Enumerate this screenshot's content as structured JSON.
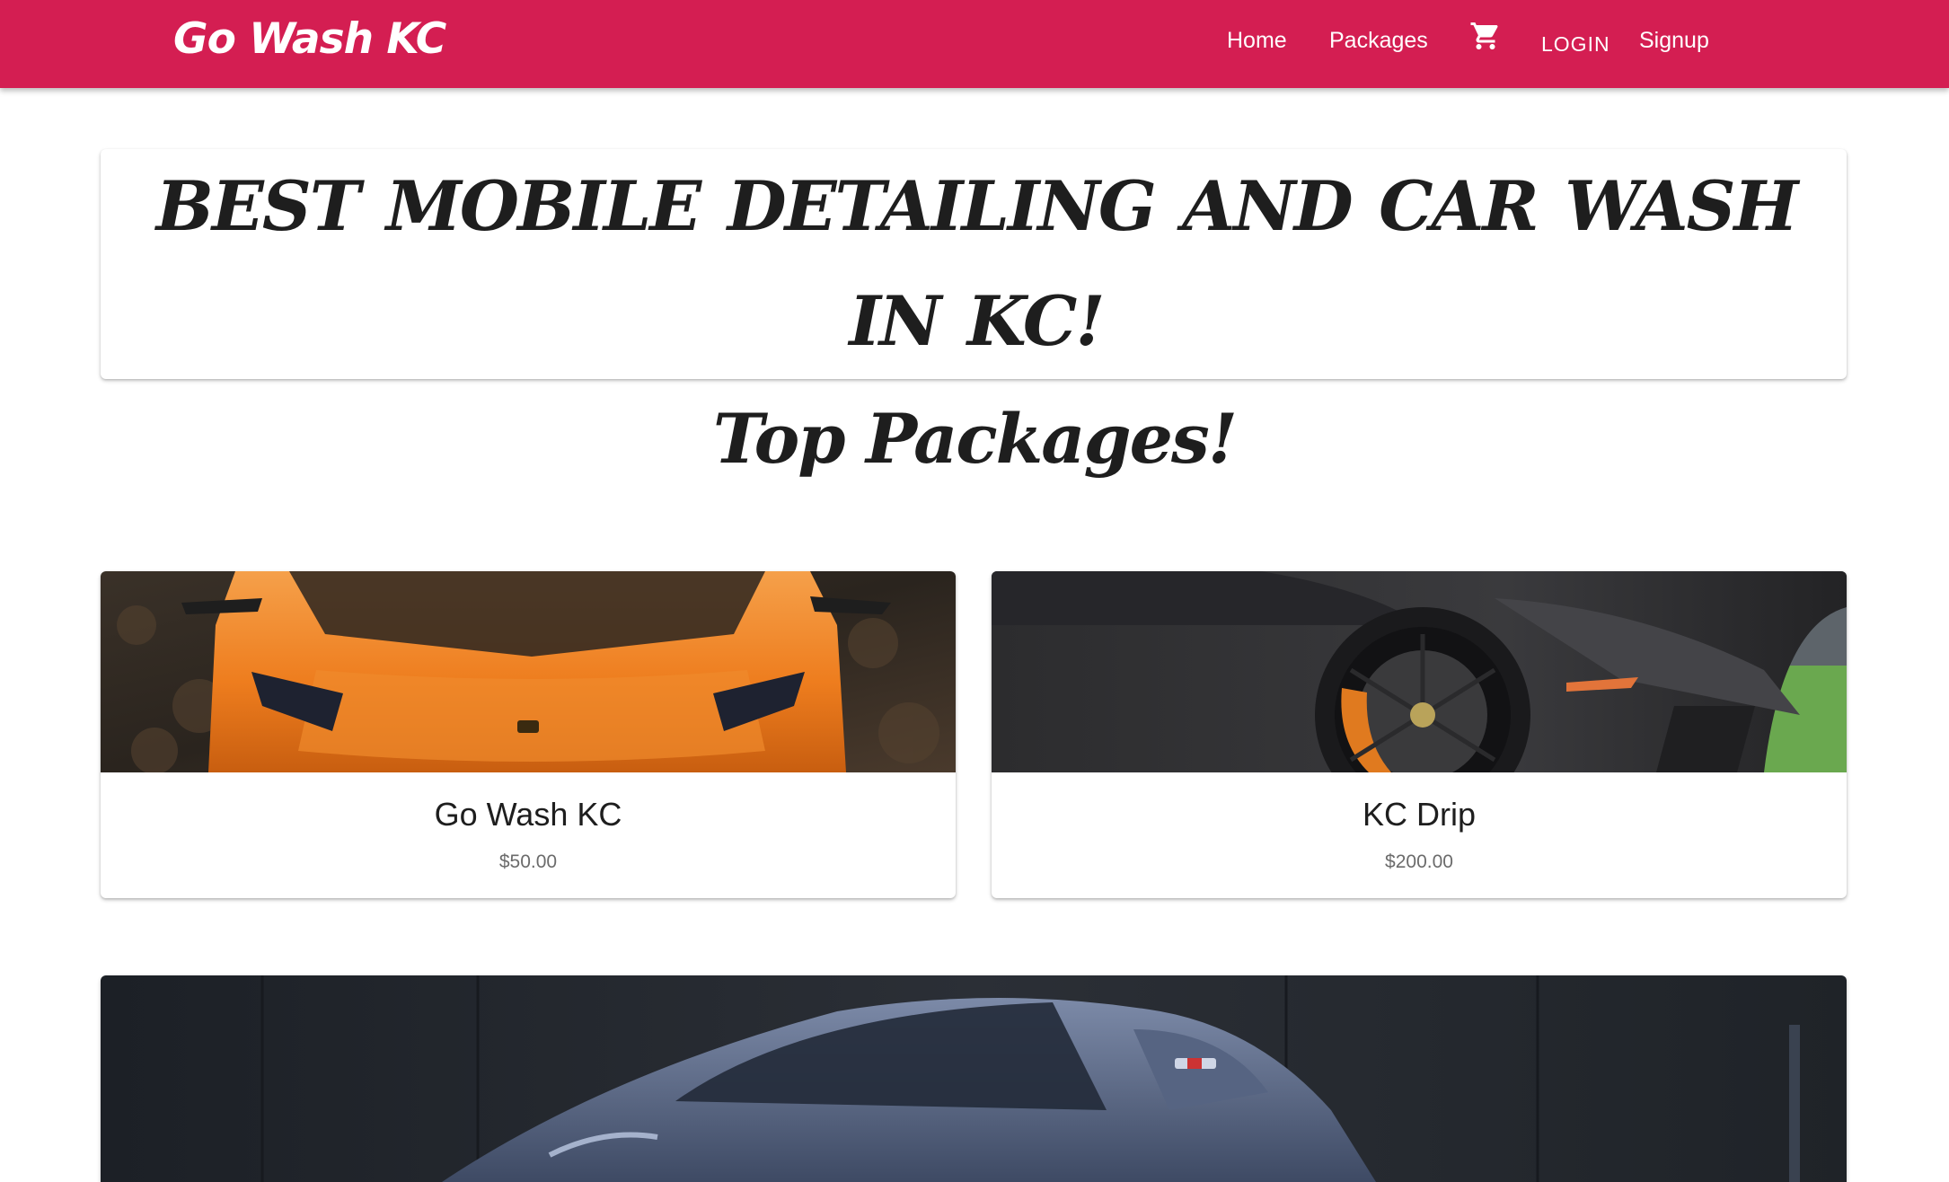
{
  "navbar": {
    "brand": "Go Wash KC",
    "links": {
      "home": "Home",
      "packages": "Packages",
      "cart_icon": "shopping-cart-icon",
      "login": "LOGIN",
      "signup": "Signup"
    },
    "color": "#d41e52"
  },
  "hero": {
    "title": "BEST MOBILE DETAILING AND CAR WASH IN KC!"
  },
  "section": {
    "title": "Top Packages!"
  },
  "packages": [
    {
      "name": "Go Wash KC",
      "price": "$50.00",
      "image": "orange-sports-car-photo"
    },
    {
      "name": "KC Drip",
      "price": "$200.00",
      "image": "black-sports-car-wheel-photo"
    }
  ],
  "feature": {
    "image": "blue-sports-car-photo"
  }
}
